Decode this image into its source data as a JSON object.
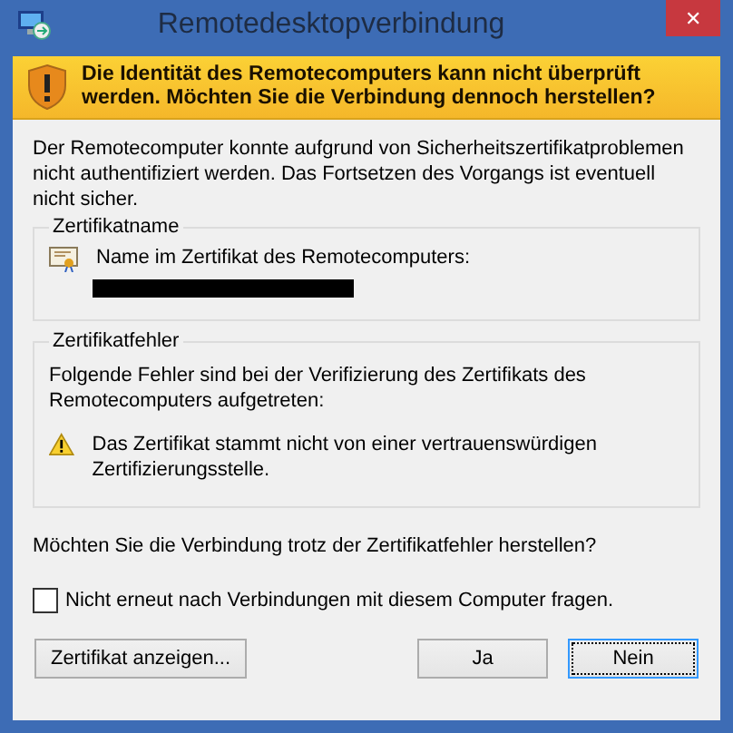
{
  "window": {
    "title": "Remotedesktopverbindung",
    "close": "✕"
  },
  "banner": {
    "text": "Die Identität des Remotecomputers kann nicht überprüft werden. Möchten Sie die Verbindung dennoch herstellen?"
  },
  "intro": "Der Remotecomputer konnte aufgrund von Sicherheitszertifikatproblemen nicht authentifiziert werden. Das Fortsetzen des Vorgangs ist eventuell nicht sicher.",
  "certificate_name": {
    "legend": "Zertifikatname",
    "label": "Name im Zertifikat des Remotecomputers:"
  },
  "certificate_errors": {
    "legend": "Zertifikatfehler",
    "text": "Folgende Fehler sind bei der Verifizierung des Zertifikats des Remotecomputers aufgetreten:",
    "errors": [
      "Das Zertifikat stammt nicht von einer vertrauenswürdigen Zertifizierungsstelle."
    ]
  },
  "question": "Möchten Sie die Verbindung trotz der Zertifikatfehler herstellen?",
  "checkbox": {
    "label": "Nicht erneut nach Verbindungen mit diesem Computer fragen.",
    "checked": false
  },
  "buttons": [
    {
      "label": "Zertifikat anzeigen...",
      "selected": false
    },
    {
      "label": "Ja",
      "selected": false
    },
    {
      "label": "Nein",
      "selected": true
    }
  ]
}
